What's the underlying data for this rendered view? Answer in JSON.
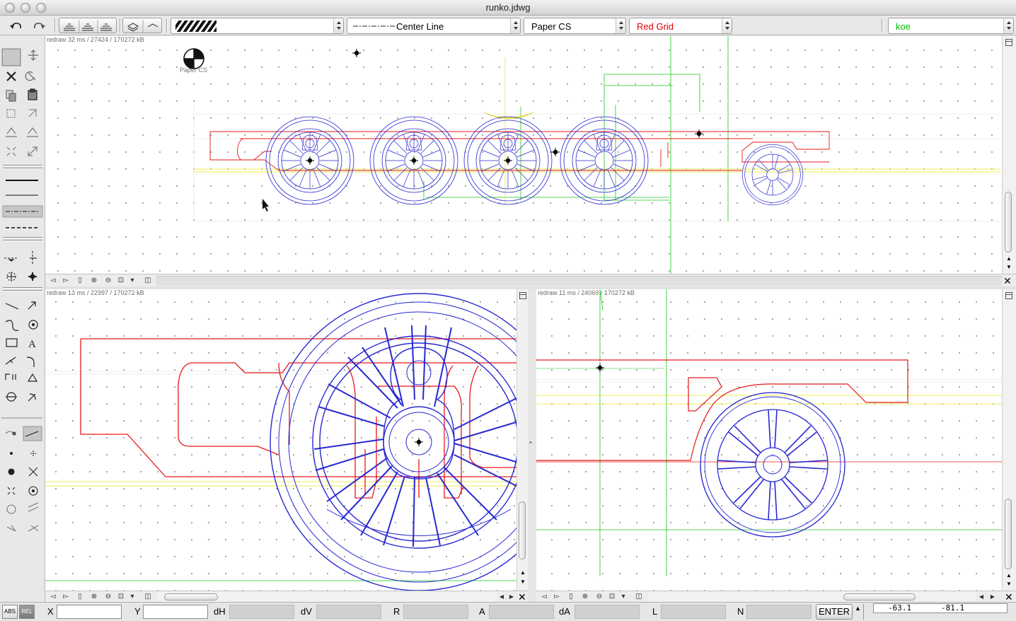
{
  "window": {
    "title": "runko.jdwg"
  },
  "toolbar": {
    "pattern_value": "",
    "linetype_value": "Center Line",
    "cs_value": "Paper CS",
    "grid_value": "Red Grid",
    "grid_color": "#e00000",
    "layer_value": "koe",
    "layer_color": "#00c000"
  },
  "views": {
    "top": {
      "redraw": "redraw 32 ms / 27424 / 170272 kB",
      "cs_label": "Paper CS"
    },
    "bottom_left": {
      "redraw": "redraw 13 ms / 22997 / 170272 kB"
    },
    "bottom_right": {
      "redraw": "redraw 11 ms / 24069 / 170272 kB"
    }
  },
  "statusbar": {
    "abs_label": "ABS",
    "rel_label": "REL",
    "x_label": "X",
    "y_label": "Y",
    "dh_label": "dH",
    "dv_label": "dV",
    "r_label": "R",
    "a_label": "A",
    "da_label": "dA",
    "l_label": "L",
    "n_label": "N",
    "enter_label": "ENTER",
    "coord_x": "-63.1",
    "coord_y": "-81.1"
  },
  "icons": {
    "undo": "undo-icon",
    "redo": "redo-icon",
    "select": "arrow-select-icon",
    "close": "close-icon",
    "snap": "snap-point-icon"
  },
  "colors": {
    "drawing_red": "#e61919",
    "drawing_blue": "#2828d2",
    "guide_green": "#1ec81e",
    "guide_yellow": "#e6e61e"
  }
}
